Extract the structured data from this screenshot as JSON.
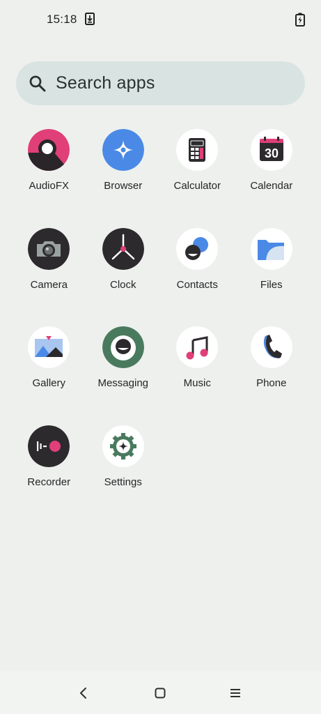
{
  "status_bar": {
    "time": "15:18",
    "icons": [
      "download-icon",
      "battery-charging-icon"
    ]
  },
  "search": {
    "placeholder": "Search apps",
    "icon": "search-icon"
  },
  "apps": [
    {
      "label": "AudioFX",
      "icon": "audiofx-icon"
    },
    {
      "label": "Browser",
      "icon": "browser-icon"
    },
    {
      "label": "Calculator",
      "icon": "calculator-icon"
    },
    {
      "label": "Calendar",
      "icon": "calendar-icon",
      "icon_text": "30"
    },
    {
      "label": "Camera",
      "icon": "camera-icon"
    },
    {
      "label": "Clock",
      "icon": "clock-icon"
    },
    {
      "label": "Contacts",
      "icon": "contacts-icon"
    },
    {
      "label": "Files",
      "icon": "files-icon"
    },
    {
      "label": "Gallery",
      "icon": "gallery-icon"
    },
    {
      "label": "Messaging",
      "icon": "messaging-icon"
    },
    {
      "label": "Music",
      "icon": "music-icon"
    },
    {
      "label": "Phone",
      "icon": "phone-icon"
    },
    {
      "label": "Recorder",
      "icon": "recorder-icon"
    },
    {
      "label": "Settings",
      "icon": "settings-icon"
    }
  ],
  "nav_bar": {
    "icons": [
      "back-icon",
      "home-icon",
      "menu-icon"
    ]
  },
  "colors": {
    "background": "#eef0ee",
    "search_bar": "#d9e4e2",
    "accent_pink": "#e03f78",
    "accent_blue": "#4a8ae6",
    "dark_icon": "#2d2a2e"
  }
}
